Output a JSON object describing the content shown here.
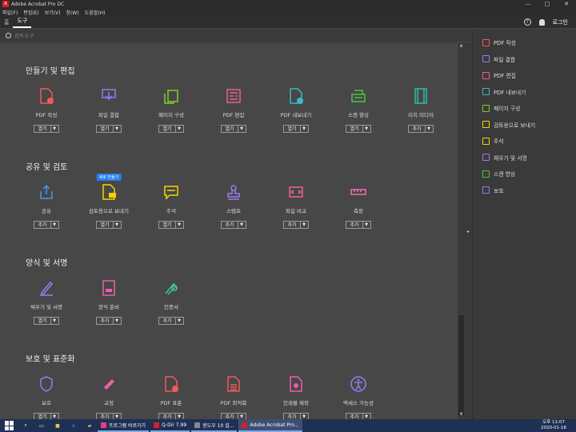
{
  "window": {
    "title": "Adobe Acrobat Pro DC",
    "logo_text": "A",
    "min": "—",
    "max": "□",
    "close": "✕"
  },
  "menu": [
    "파일(F)",
    "편집(E)",
    "보기(V)",
    "창(W)",
    "도움말(H)"
  ],
  "tabs": {
    "home": "홈",
    "tools": "도구"
  },
  "header": {
    "help": "?",
    "login": "로그인"
  },
  "search": {
    "placeholder": "검색 도구"
  },
  "sections": [
    {
      "title": "만들기 및 편집"
    },
    {
      "title": "공유 및 검토"
    },
    {
      "title": "양식 및 서명"
    },
    {
      "title": "보호 및 표준화"
    }
  ],
  "tools": {
    "create_edit": [
      {
        "label": "PDF 작성",
        "button": "열기",
        "icon": "pdf-create-icon",
        "color": "#ef5a5a"
      },
      {
        "label": "파일 결합",
        "button": "열기",
        "icon": "combine-files-icon",
        "color": "#8f7cf6"
      },
      {
        "label": "페이지 구성",
        "button": "열기",
        "icon": "organize-pages-icon",
        "color": "#7ed321"
      },
      {
        "label": "PDF 편집",
        "button": "열기",
        "icon": "edit-pdf-icon",
        "color": "#ef5f8a"
      },
      {
        "label": "PDF 내보내기",
        "button": "열기",
        "icon": "export-pdf-icon",
        "color": "#3cb8c4"
      },
      {
        "label": "스캔 향상",
        "button": "열기",
        "icon": "scan-enhance-icon",
        "color": "#45c945"
      },
      {
        "label": "리치 미디어",
        "button": "추가",
        "icon": "rich-media-icon",
        "color": "#2fbfa3"
      }
    ],
    "share_review": [
      {
        "label": "공유",
        "button": "추가",
        "icon": "share-icon",
        "color": "#3a9bf4"
      },
      {
        "label": "검토용으로 보내기",
        "button": "열기",
        "icon": "send-for-review-icon",
        "color": "#f5d400",
        "badge": "새로 만들기"
      },
      {
        "label": "주석",
        "button": "열기",
        "icon": "comment-icon",
        "color": "#f5d400"
      },
      {
        "label": "스탬프",
        "button": "추가",
        "icon": "stamp-icon",
        "color": "#9b7cf6"
      },
      {
        "label": "파일 비교",
        "button": "추가",
        "icon": "compare-files-icon",
        "color": "#ef5f9a"
      },
      {
        "label": "측정",
        "button": "추가",
        "icon": "measure-icon",
        "color": "#ef6fb0"
      }
    ],
    "forms_sign": [
      {
        "label": "채우기 및 서명",
        "button": "열기",
        "icon": "fill-sign-icon",
        "color": "#9b7cf6"
      },
      {
        "label": "양식 준비",
        "button": "추가",
        "icon": "prepare-form-icon",
        "color": "#ef5fa8"
      },
      {
        "label": "인증서",
        "button": "추가",
        "icon": "certificate-icon",
        "color": "#3cc8a8"
      }
    ],
    "protect": [
      {
        "label": "보호",
        "button": "열기",
        "icon": "protect-icon",
        "color": "#8f7cf6"
      },
      {
        "label": "교정",
        "button": "추가",
        "icon": "redact-icon",
        "color": "#ef5fa8"
      },
      {
        "label": "PDF 표준",
        "button": "추가",
        "icon": "pdf-standards-icon",
        "color": "#ef5a5a"
      },
      {
        "label": "PDF 최적화",
        "button": "추가",
        "icon": "optimize-pdf-icon",
        "color": "#ef5a5a"
      },
      {
        "label": "인쇄물 제작",
        "button": "추가",
        "icon": "print-production-icon",
        "color": "#ef5fa8"
      },
      {
        "label": "액세스 가능성",
        "button": "추가",
        "icon": "accessibility-icon",
        "color": "#9b7cf6"
      }
    ]
  },
  "right_panel": [
    {
      "label": "PDF 작성",
      "color": "#ef5a5a"
    },
    {
      "label": "파일 결합",
      "color": "#8f7cf6"
    },
    {
      "label": "PDF 편집",
      "color": "#ef5f8a"
    },
    {
      "label": "PDF 내보내기",
      "color": "#3cb8c4"
    },
    {
      "label": "페이지 구성",
      "color": "#7ed321"
    },
    {
      "label": "검토용으로 보내기",
      "color": "#f5d400"
    },
    {
      "label": "주석",
      "color": "#f5d400"
    },
    {
      "label": "채우기 및 서명",
      "color": "#9b7cf6"
    },
    {
      "label": "스캔 향상",
      "color": "#45c945"
    },
    {
      "label": "보호",
      "color": "#8f7cf6"
    }
  ],
  "taskbar": {
    "apps": [
      {
        "label": "프로그램 바로가기",
        "color": "#e83a8a"
      },
      {
        "label": "Q-Dir 7.99",
        "color": "#d71f26"
      },
      {
        "label": "윈도우 10 설...",
        "color": "#888888"
      },
      {
        "label": "Adobe Acrobat Pro...",
        "color": "#d71f26"
      }
    ],
    "time": "오후 11:07",
    "date": "2020-01-16"
  }
}
